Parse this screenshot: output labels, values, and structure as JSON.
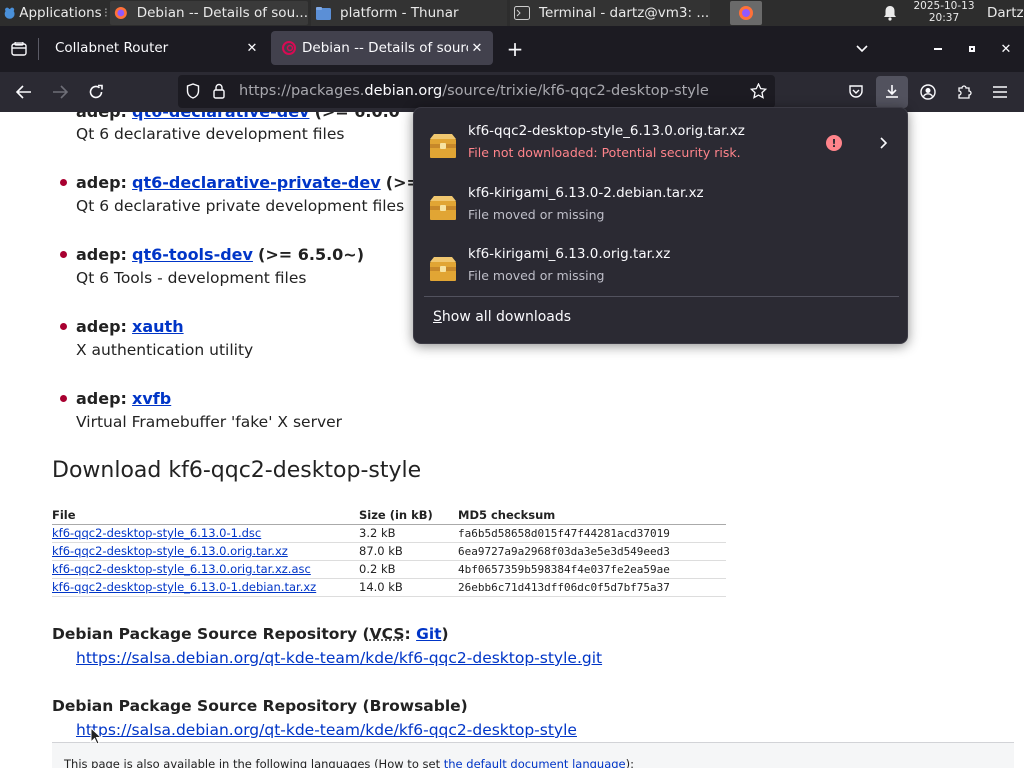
{
  "panel": {
    "applications_label": "Applications",
    "tasks": [
      {
        "label": "Debian -- Details of sou..."
      },
      {
        "label": "platform - Thunar"
      },
      {
        "label": "Terminal - dartz@vm3: ..."
      }
    ],
    "clock_date": "2025-10-13",
    "clock_time": "20:37",
    "user": "Dartz"
  },
  "tabs": [
    {
      "label": "Collabnet Router"
    },
    {
      "label": "Debian -- Details of source"
    }
  ],
  "url": {
    "prefix": "https://packages.",
    "domain": "debian.org",
    "path": "/source/trixie/kf6-qqc2-desktop-style"
  },
  "deps": [
    {
      "kind": "adep:",
      "name": "qt6-declarative-dev",
      "ver": "(>= 6.0.0",
      "desc": "Qt 6 declarative development files"
    },
    {
      "kind": "adep:",
      "name": "qt6-declarative-private-dev",
      "ver": "(>=",
      "desc": "Qt 6 declarative private development files"
    },
    {
      "kind": "adep:",
      "name": "qt6-tools-dev",
      "ver": "(>= 6.5.0~)",
      "desc": "Qt 6 Tools - development files"
    },
    {
      "kind": "adep:",
      "name": "xauth",
      "ver": "",
      "desc": "X authentication utility"
    },
    {
      "kind": "adep:",
      "name": "xvfb",
      "ver": "",
      "desc": "Virtual Framebuffer 'fake' X server"
    }
  ],
  "download": {
    "heading": "Download kf6-qqc2-desktop-style",
    "columns": [
      "File",
      "Size (in kB)",
      "MD5 checksum"
    ],
    "rows": [
      {
        "file": "kf6-qqc2-desktop-style_6.13.0-1.dsc",
        "size": "3.2 kB",
        "md5": "fa6b5d58658d015f47f44281acd37019"
      },
      {
        "file": "kf6-qqc2-desktop-style_6.13.0.orig.tar.xz",
        "size": "87.0 kB",
        "md5": "6ea9727a9a2968f03da3e5e3d549eed3"
      },
      {
        "file": "kf6-qqc2-desktop-style_6.13.0.orig.tar.xz.asc",
        "size": "0.2 kB",
        "md5": "4bf0657359b598384f4e037fe2ea59ae"
      },
      {
        "file": "kf6-qqc2-desktop-style_6.13.0-1.debian.tar.xz",
        "size": "14.0 kB",
        "md5": "26ebb6c71d413dff06dc0f5d7bf75a37"
      }
    ]
  },
  "repo_vcs": {
    "prefix": "Debian Package Source Repository (",
    "abbr": "VCS",
    "colon": ": ",
    "link": "Git",
    "suffix": ")",
    "url": "https://salsa.debian.org/qt-kde-team/kde/kf6-qqc2-desktop-style.git"
  },
  "repo_browse": {
    "title": "Debian Package Source Repository (Browsable)",
    "url": "https://salsa.debian.org/qt-kde-team/kde/kf6-qqc2-desktop-style"
  },
  "language_bar": {
    "prefix": "This page is also available in the following languages (How to set ",
    "link": "the default document language",
    "suffix": "):"
  },
  "downloads_panel": {
    "items": [
      {
        "filename": "kf6-qqc2-desktop-style_6.13.0.orig.tar.xz",
        "status": "File not downloaded: Potential security risk."
      },
      {
        "filename": "kf6-kirigami_6.13.0-2.debian.tar.xz",
        "status": "File moved or missing"
      },
      {
        "filename": "kf6-kirigami_6.13.0.orig.tar.xz",
        "status": "File moved or missing"
      }
    ],
    "show_all_accesskey": "S",
    "show_all_rest": "how all downloads"
  },
  "colors": {
    "link": "#0035c7",
    "bullet": "#a80030",
    "error": "#ff848b",
    "panel_bg": "#2b2a33"
  }
}
